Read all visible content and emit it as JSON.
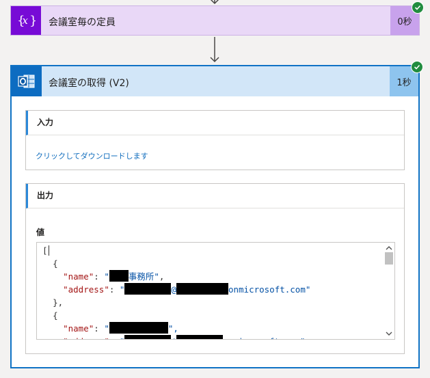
{
  "actions": [
    {
      "title": "会議室毎の定員",
      "duration": "0秒",
      "icon": "variable-icon",
      "status": "succeeded",
      "colors": {
        "header": "#e9d8f7",
        "icon_bg": "#770bd6",
        "duration_bg": "#c8a2ec"
      }
    },
    {
      "title": "会議室の取得 (V2)",
      "duration": "1秒",
      "icon": "outlook-icon",
      "status": "succeeded",
      "colors": {
        "header": "#d2e6f8",
        "icon_bg": "#0d6cc1",
        "duration_bg": "#8ec4ee",
        "border": "#0f72c5"
      },
      "inputs": {
        "heading": "入力",
        "download_link": "クリックしてダウンロードします"
      },
      "outputs": {
        "heading": "出力",
        "value_label": "値",
        "code": {
          "open_bracket": "[",
          "open_brace": "{",
          "close_brace": "},",
          "name_key": "\"name\"",
          "address_key": "\"address\"",
          "colon": ": ",
          "quote": "\"",
          "comma": ",",
          "room1_name_suffix": "事務所\"",
          "address_at": "@",
          "address_domain": "onmicrosoft.com\"",
          "room2_name_suffix": "\","
        }
      }
    }
  ]
}
